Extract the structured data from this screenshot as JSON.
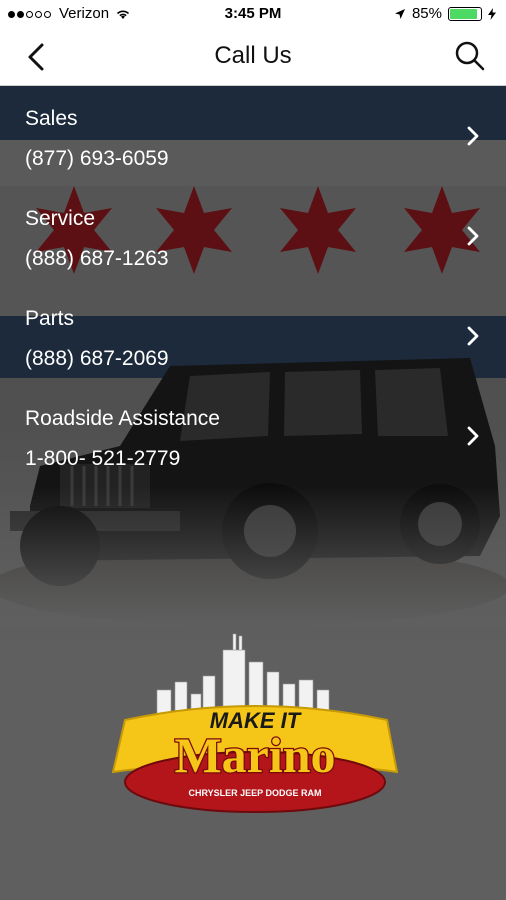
{
  "status_bar": {
    "carrier": "Verizon",
    "time": "3:45 PM",
    "battery_percent": "85%",
    "battery_level": 0.85
  },
  "nav": {
    "title": "Call Us",
    "back_icon": "chevron-left-icon",
    "search_icon": "search-icon"
  },
  "contacts": [
    {
      "label": "Sales",
      "phone": "(877) 693-6059"
    },
    {
      "label": "Service",
      "phone": "(888) 687-1263"
    },
    {
      "label": "Parts",
      "phone": "(888) 687-2069"
    },
    {
      "label": "Roadside Assistance",
      "phone": "1-800- 521-2779"
    }
  ],
  "logo": {
    "top_text": "MAKE IT",
    "main_text": "Marino",
    "sub_text": "CHRYSLER JEEP DODGE RAM"
  },
  "colors": {
    "flag_blue": "#1c2a3c",
    "star_red": "#5c1014",
    "logo_yellow": "#f5c518",
    "logo_red": "#b3151b"
  }
}
